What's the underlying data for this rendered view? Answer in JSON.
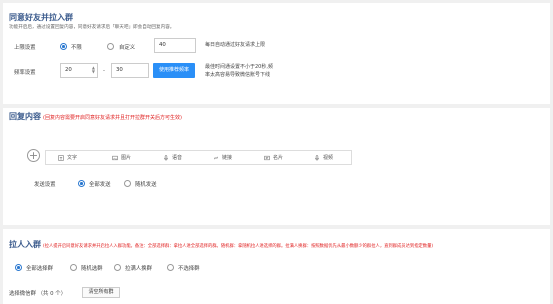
{
  "section1": {
    "title": "同意好友并拉入群",
    "subtitle": "功能开启后，通过设置回复内容，同意好友请求后「聊天吧」即会自动回复内容。",
    "limit": {
      "label": "上限设置",
      "option_unlimited": "不限",
      "option_custom": "自定义",
      "value": "40",
      "hint": "每日自动通过好友请求上限"
    },
    "delay": {
      "label": "频率设置",
      "from": "20",
      "separator": "-",
      "to": "30",
      "button": "使用推荐频率",
      "hint_line1": "最佳时间通设置不小于20秒,频",
      "hint_line2": "率太高容易导致微信账号下线"
    }
  },
  "section2": {
    "title": "回复内容",
    "note": "(回复内容需要开启同意好友请求并且打开拉群开关后方可生效)",
    "tools": [
      {
        "label": "文字",
        "icon": "text-icon"
      },
      {
        "label": "图片",
        "icon": "image-icon"
      },
      {
        "label": "语音",
        "icon": "microphone-icon"
      },
      {
        "label": "链接",
        "icon": "link-icon"
      },
      {
        "label": "名片",
        "icon": "card-icon"
      },
      {
        "label": "视频",
        "icon": "video-icon"
      }
    ],
    "send": {
      "label": "发送设置",
      "option_all": "全部发送",
      "option_random": "随机发送"
    }
  },
  "section3": {
    "title": "拉人入群",
    "note": "(拉人提开启同意好友请求并开启拉人入群功能。备注：全部选择群：拿拉人进全部选择的群。随机群：拿随机拉人进选择的群。拉满人换群：按照数据优先从最小数额少的群拉人，直到群成员达到指定数量)",
    "options": [
      "全部选择群",
      "随机选群",
      "拉满人换群",
      "不选择群"
    ],
    "selected_label": "选择微信群 （共 0 个）",
    "clear_button": "清空所有群"
  },
  "colors": {
    "accent": "#2a8ff7",
    "title": "#3a5a8c",
    "warning": "#e02020"
  }
}
